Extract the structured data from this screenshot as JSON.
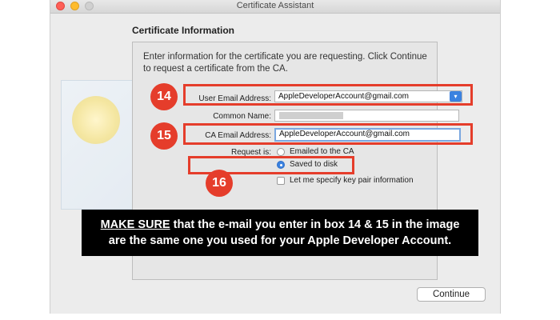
{
  "window": {
    "title": "Certificate Assistant"
  },
  "section_title": "Certificate Information",
  "intro_text": "Enter information for the certificate you are requesting. Click Continue to request a certificate from the CA.",
  "form": {
    "user_email_label": "User Email Address:",
    "user_email_value": "AppleDeveloperAccount@gmail.com",
    "common_name_label": "Common Name:",
    "ca_email_label": "CA Email Address:",
    "ca_email_value": "AppleDeveloperAccount@gmail.com",
    "request_label": "Request is:",
    "options": {
      "emailed": "Emailed to the CA",
      "saved": "Saved to disk",
      "keypair": "Let me specify key pair information"
    },
    "selected_option": "saved"
  },
  "annotations": {
    "badge_14": "14",
    "badge_15": "15",
    "badge_16": "16",
    "accent_color": "#e53d2b"
  },
  "banner": {
    "emphasis": "MAKE SURE",
    "line1_rest": " that the e-mail you enter in box 14 & 15 in the image",
    "line2": "are the same one you used for your Apple Developer Account."
  },
  "buttons": {
    "continue": "Continue"
  },
  "colors": {
    "selection_blue": "#3b82e0"
  }
}
